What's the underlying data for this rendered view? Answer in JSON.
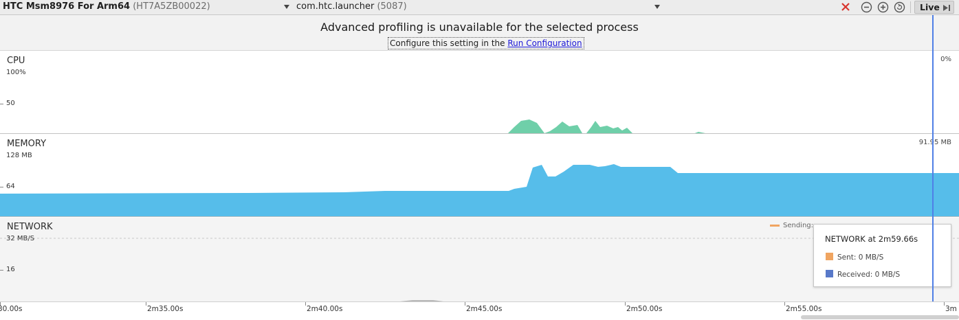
{
  "toolbar": {
    "device_name": "HTC Msm8976 For Arm64",
    "device_serial": "(HT7A5ZB00022)",
    "process_name": "com.htc.launcher",
    "process_pid": "(5087)",
    "live_label": "Live",
    "icons": [
      "close-icon",
      "zoom-out-icon",
      "zoom-in-icon",
      "reset-zoom-icon",
      "go-live-icon"
    ]
  },
  "banner": {
    "title": "Advanced profiling is unavailable for the selected process",
    "subtitle_prefix": "Configure this setting in the ",
    "subtitle_link": "Run Configuration"
  },
  "cpu": {
    "title": "CPU",
    "tick_top": "100%",
    "tick_mid": "50",
    "current_value": "0%",
    "color": "#6fcfa9"
  },
  "memory": {
    "title": "MEMORY",
    "tick_top": "128 MB",
    "tick_mid": "64",
    "current_value": "91.95 MB",
    "color": "#56bdea"
  },
  "network": {
    "title": "NETWORK",
    "tick_top": "32 MB/S",
    "tick_mid": "16",
    "legend_sending": "Sending:",
    "sending_color": "#f0a561",
    "received_color": "#5879c9"
  },
  "tooltip": {
    "title": "NETWORK at 2m59.66s",
    "sent": "Sent: 0 MB/S",
    "received": "Received: 0 MB/S"
  },
  "time_axis": {
    "labels": [
      "30.00s",
      "2m35.00s",
      "2m40.00s",
      "2m45.00s",
      "2m50.00s",
      "2m55.00s",
      "3m"
    ]
  }
}
